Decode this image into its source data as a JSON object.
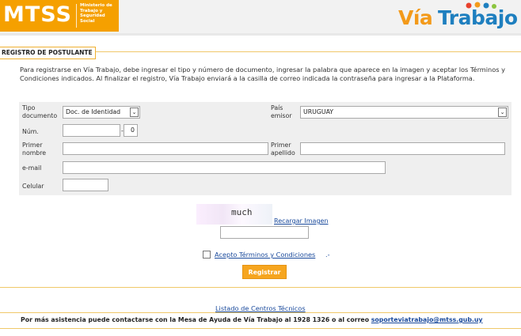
{
  "header": {
    "logo_text": "MTSS",
    "ministry_text": "Ministerio de Trabajo y Seguridad Social",
    "brand_via": "Vía",
    "brand_trabajo": "Trabajo",
    "colors": {
      "mtss_orange": "#f5a000",
      "via_orange": "#f39a1a",
      "trabajo_blue": "#1e7fbf"
    }
  },
  "section": {
    "title": "REGISTRO DE POSTULANTE"
  },
  "intro": "Para registrarse en Vía Trabajo, debe ingresar el tipo y número de documento, ingresar la palabra que aparece en la imagen y aceptar los Términos y Condiciones indicados. Al finalizar el registro, Vía Trabajo enviará a la casilla de correo indicada la contraseña para ingresar a la Plataforma.",
  "form": {
    "doc_type_label": "Tipo documento",
    "doc_type_value": "Doc. de Identidad",
    "country_label": "País emisor",
    "country_value": "URUGUAY",
    "num_label": "Núm.",
    "num_value": "",
    "num_dash": "-",
    "num_check_value": "0",
    "first_name_label": "Primer nombre",
    "first_name_value": "",
    "last_name_label": "Primer apellido",
    "last_name_value": "",
    "email_label": "e-mail",
    "email_value": "",
    "phone_label": "Celular",
    "phone_value": ""
  },
  "captcha": {
    "word": "much",
    "reload_label": "Recargar Imagen",
    "input_value": ""
  },
  "terms": {
    "label": "Acepto Términos y Condiciones",
    "suffix": ".-",
    "checked": false
  },
  "register_button": "Registrar",
  "footer": {
    "centers_link": "Listado de Centros Técnicos",
    "help_text": "Por más asistencia puede contactarse con la Mesa de Ayuda de Vía Trabajo al 1928 1326 o al correo",
    "help_email": "soporteviatrabajo@mtss.gub.uy"
  }
}
